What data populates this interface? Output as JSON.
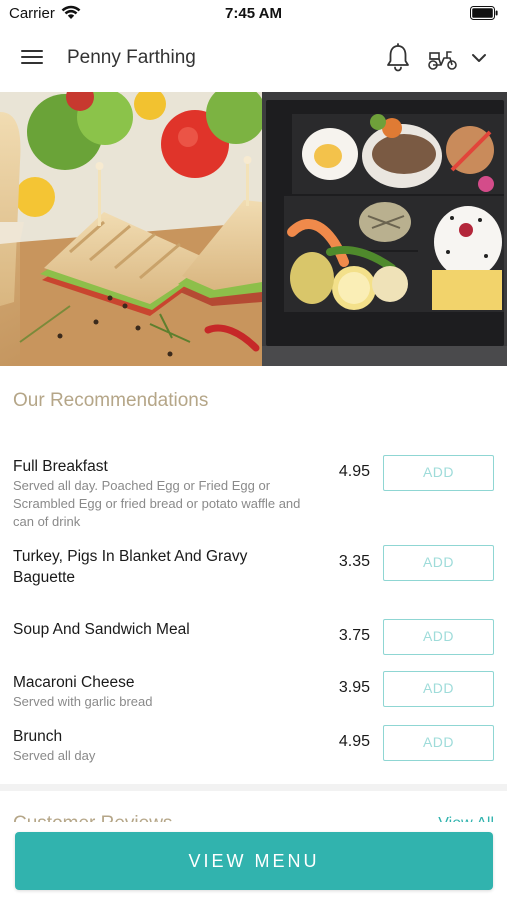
{
  "status_bar": {
    "carrier": "Carrier",
    "time": "7:45 AM"
  },
  "header": {
    "title": "Penny Farthing"
  },
  "icons": {
    "menu": "hamburger-icon",
    "notifications": "bell-icon",
    "delivery": "scooter-icon",
    "dropdown": "chevron-down-icon"
  },
  "recommendations": {
    "title": "Our Recommendations",
    "add_label": "ADD",
    "items": [
      {
        "name": "Full Breakfast",
        "description": "Served all day.  Poached Egg or Fried Egg or Scrambled Egg or fried bread or potato waffle and can of drink",
        "price": "4.95"
      },
      {
        "name": "Turkey, Pigs In Blanket And Gravy Baguette",
        "description": "",
        "price": "3.35"
      },
      {
        "name": "Soup And Sandwich Meal",
        "description": "",
        "price": "3.75"
      },
      {
        "name": "Macaroni Cheese",
        "description": "Served with garlic bread",
        "price": "3.95"
      },
      {
        "name": "Brunch",
        "description": "Served all day",
        "price": "4.95"
      }
    ]
  },
  "reviews": {
    "title": "Customer Reviews",
    "view_all": "View All"
  },
  "footer": {
    "view_menu": "VIEW MENU"
  },
  "colors": {
    "accent": "#31b3ae",
    "section_title": "#b5a688",
    "add_border": "#8fd6d3"
  }
}
